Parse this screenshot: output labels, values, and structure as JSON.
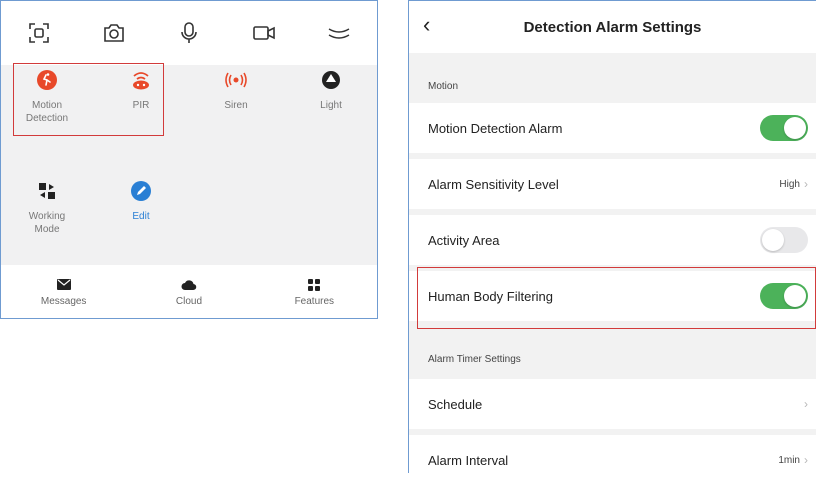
{
  "left": {
    "toolbar": [
      {
        "name": "screenshot-icon"
      },
      {
        "name": "camera-icon"
      },
      {
        "name": "microphone-icon"
      },
      {
        "name": "video-record-icon"
      },
      {
        "name": "collapse-icon"
      }
    ],
    "features": [
      {
        "label": "Motion\nDetection",
        "icon": "motion-detection-icon",
        "color": "#e8492a"
      },
      {
        "label": "PIR",
        "icon": "pir-icon",
        "color": "#e8492a"
      },
      {
        "label": "Siren",
        "icon": "siren-icon",
        "color": "#e8492a"
      },
      {
        "label": "Light",
        "icon": "light-icon",
        "color": "#222222"
      },
      {
        "label": "Working\nMode",
        "icon": "working-mode-icon",
        "color": "#222222"
      },
      {
        "label": "Edit",
        "icon": "edit-icon",
        "color": "#2a7fd4"
      }
    ],
    "nav": [
      {
        "label": "Messages",
        "icon": "messages-icon"
      },
      {
        "label": "Cloud",
        "icon": "cloud-icon"
      },
      {
        "label": "Features",
        "icon": "features-icon"
      }
    ]
  },
  "right": {
    "title": "Detection Alarm Settings",
    "back_icon": "chevron-left-icon",
    "section_motion": "Motion",
    "motion_detection_alarm": {
      "label": "Motion Detection Alarm",
      "state": "on"
    },
    "alarm_sensitivity": {
      "label": "Alarm Sensitivity Level",
      "value": "High"
    },
    "activity_area": {
      "label": "Activity Area",
      "state": "off"
    },
    "human_body_filtering": {
      "label": "Human Body Filtering",
      "state": "on"
    },
    "section_timer": "Alarm Timer Settings",
    "schedule": {
      "label": "Schedule"
    },
    "alarm_interval": {
      "label": "Alarm Interval",
      "value": "1min"
    }
  },
  "colors": {
    "accent_green": "#4cb25a",
    "highlight_red": "#d23b3b",
    "brand_red": "#e8492a",
    "link_blue": "#2a7fd4"
  }
}
